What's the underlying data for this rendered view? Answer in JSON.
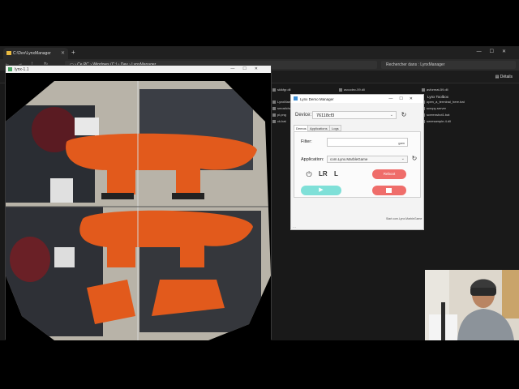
{
  "explorer": {
    "tab_title": "C:\\Dev\\LynxManager",
    "new_tab": "+",
    "address_parts": [
      "Ce PC",
      "Windows (C:)",
      "Dev",
      "LynxManager"
    ],
    "search_placeholder": "Rechercher dans : LynxManager",
    "details_label": "Détails",
    "files_left": [
      "sklkfgr.dll",
      "LynxManager.p",
      "smosfchat",
      "pi.png",
      "ck.bat"
    ],
    "files_mid": [
      "avcodec-59.dll"
    ],
    "files_right": [
      "avformat-59.dll",
      "Lynx Toolbox",
      "open_a_terminal_here.bat",
      "scrcpy-server",
      "screenshot1.bat",
      "swresample-4.dll"
    ]
  },
  "lynx_window": {
    "title": "lynx-1.1"
  },
  "demo_manager": {
    "title": "Lynx Demo Manager",
    "device_label": "Device:",
    "device_value": "76118cf3",
    "tabs": [
      "Demos",
      "Applications",
      "Logs"
    ],
    "active_tab": "Demos",
    "filter_label": "Filter:",
    "filter_value": "gam",
    "application_label": "Application:",
    "application_value": "com.Lynx.MarbleGame",
    "lr_label": "LR",
    "l_label": "L",
    "reboot_label": "Reboot",
    "play_symbol": "▶",
    "status_text": "Start com.Lynx.MarbleGame"
  },
  "icons": {
    "refresh": "refresh-icon",
    "power": "power-icon",
    "play": "play-icon",
    "stop": "stop-icon"
  },
  "colors": {
    "reboot": "#ef6d6a",
    "play": "#7fe0d8",
    "stop": "#ef6d6a"
  }
}
